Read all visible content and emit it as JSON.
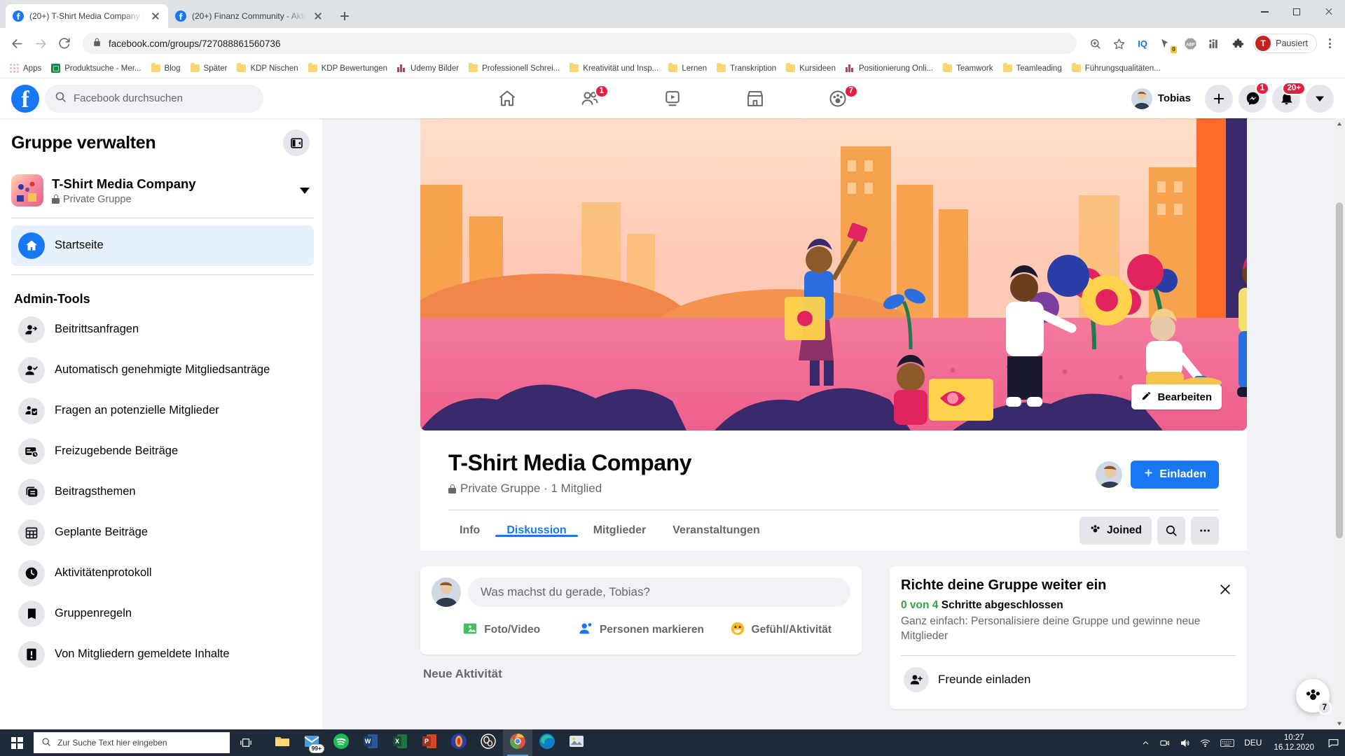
{
  "browser": {
    "tabs": [
      {
        "title": "(20+) T-Shirt Media Company | F",
        "active": true
      },
      {
        "title": "(20+) Finanz Community - Aktie",
        "active": false
      }
    ],
    "url_text": "facebook.com/groups/727088861560736",
    "profile_label": "Pausiert",
    "profile_initial": "T",
    "bookmarks": [
      {
        "label": "Apps",
        "icon": "apps-grid-icon"
      },
      {
        "label": "Produktsuche - Mer...",
        "icon": "green-app-icon"
      },
      {
        "label": "Blog",
        "icon": "folder-icon"
      },
      {
        "label": "Später",
        "icon": "folder-icon"
      },
      {
        "label": "KDP Nischen",
        "icon": "folder-icon"
      },
      {
        "label": "KDP Bewertungen",
        "icon": "folder-icon"
      },
      {
        "label": "Udemy Bilder",
        "icon": "udemy-icon"
      },
      {
        "label": "Professionell Schrei...",
        "icon": "folder-icon"
      },
      {
        "label": "Kreativität und Insp...",
        "icon": "folder-icon"
      },
      {
        "label": "Lernen",
        "icon": "folder-icon"
      },
      {
        "label": "Transkription",
        "icon": "folder-icon"
      },
      {
        "label": "Kursideen",
        "icon": "folder-icon"
      },
      {
        "label": "Positionierung Onli...",
        "icon": "udemy-icon"
      },
      {
        "label": "Teamwork",
        "icon": "folder-icon"
      },
      {
        "label": "Teamleading",
        "icon": "folder-icon"
      },
      {
        "label": "Führungsqualitäten...",
        "icon": "folder-icon"
      }
    ],
    "extensions": [
      "zoom-icon",
      "star-icon",
      "iq-icon",
      "shortcut-icon",
      "abp-icon",
      "grid-icon",
      "puzzle-icon"
    ]
  },
  "facebook": {
    "search_placeholder": "Facebook durchsuchen",
    "nav": [
      {
        "name": "home",
        "badge": null
      },
      {
        "name": "friends",
        "badge": "1"
      },
      {
        "name": "watch",
        "badge": null
      },
      {
        "name": "marketplace",
        "badge": null
      },
      {
        "name": "groups",
        "badge": "7"
      }
    ],
    "user_name": "Tobias",
    "messenger_badge": "1",
    "notifications_badge": "20+"
  },
  "sidebar": {
    "title": "Gruppe verwalten",
    "group_name": "T-Shirt Media Company",
    "group_privacy": "Private Gruppe",
    "home_item": "Startseite",
    "section_title": "Admin-Tools",
    "items": [
      {
        "label": "Beitrittsanfragen",
        "icon": "person-add-icon"
      },
      {
        "label": "Automatisch genehmigte Mitgliedsanträge",
        "icon": "person-check-icon"
      },
      {
        "label": "Fragen an potenzielle Mitglieder",
        "icon": "person-question-icon"
      },
      {
        "label": "Freizugebende Beiträge",
        "icon": "post-clock-icon"
      },
      {
        "label": "Beitragsthemen",
        "icon": "layers-icon"
      },
      {
        "label": "Geplante Beiträge",
        "icon": "calendar-icon"
      },
      {
        "label": "Aktivitätenprotokoll",
        "icon": "clock-icon"
      },
      {
        "label": "Gruppenregeln",
        "icon": "book-icon"
      },
      {
        "label": "Von Mitgliedern gemeldete Inhalte",
        "icon": "alert-icon"
      }
    ]
  },
  "group": {
    "cover_edit_label": "Bearbeiten",
    "name": "T-Shirt Media Company",
    "meta": "Private Gruppe · 1 Mitglied",
    "invite_label": "Einladen",
    "tabs": [
      {
        "label": "Info",
        "active": false
      },
      {
        "label": "Diskussion",
        "active": true
      },
      {
        "label": "Mitglieder",
        "active": false
      },
      {
        "label": "Veranstaltungen",
        "active": false
      }
    ],
    "joined_label": "Joined"
  },
  "composer": {
    "placeholder": "Was machst du gerade, Tobias?",
    "actions": [
      {
        "label": "Foto/Video",
        "icon": "photo-video-icon"
      },
      {
        "label": "Personen markieren",
        "icon": "tag-person-icon"
      },
      {
        "label": "Gefühl/Aktivität",
        "icon": "emoji-icon"
      }
    ],
    "new_activity_label": "Neue Aktivität"
  },
  "setup_card": {
    "title": "Richte deine Gruppe weiter ein",
    "steps_progress": "0 von 4",
    "steps_suffix": "Schritte abgeschlossen",
    "description": "Ganz einfach: Personalisiere deine Gruppe und gewinne neue Mitglieder",
    "items": [
      {
        "label": "Freunde einladen",
        "icon": "person-add-icon"
      }
    ]
  },
  "chat_fab": {
    "badge": "7"
  },
  "taskbar": {
    "search_placeholder": "Zur Suche Text hier eingeben",
    "apps": [
      {
        "name": "file-explorer-icon",
        "count": null,
        "running": false
      },
      {
        "name": "mail-icon",
        "count": "99+",
        "running": false
      },
      {
        "name": "spotify-icon",
        "count": null,
        "running": false
      },
      {
        "name": "word-icon",
        "count": null,
        "running": false
      },
      {
        "name": "excel-icon",
        "count": null,
        "running": false
      },
      {
        "name": "powerpoint-icon",
        "count": null,
        "running": false
      },
      {
        "name": "audacity-icon",
        "count": null,
        "running": false
      },
      {
        "name": "obs-icon",
        "count": null,
        "running": false
      },
      {
        "name": "chrome-icon",
        "count": null,
        "running": true
      },
      {
        "name": "edge-icon",
        "count": null,
        "running": false
      },
      {
        "name": "photos-icon",
        "count": null,
        "running": false
      }
    ],
    "tray_lang": "DEU",
    "clock_time": "10:27",
    "clock_date": "16.12.2020"
  },
  "colors": {
    "fb_blue": "#1877f2",
    "badge_red": "#e41e3f",
    "green": "#31a24c",
    "taskbar": "#1f2a38"
  }
}
